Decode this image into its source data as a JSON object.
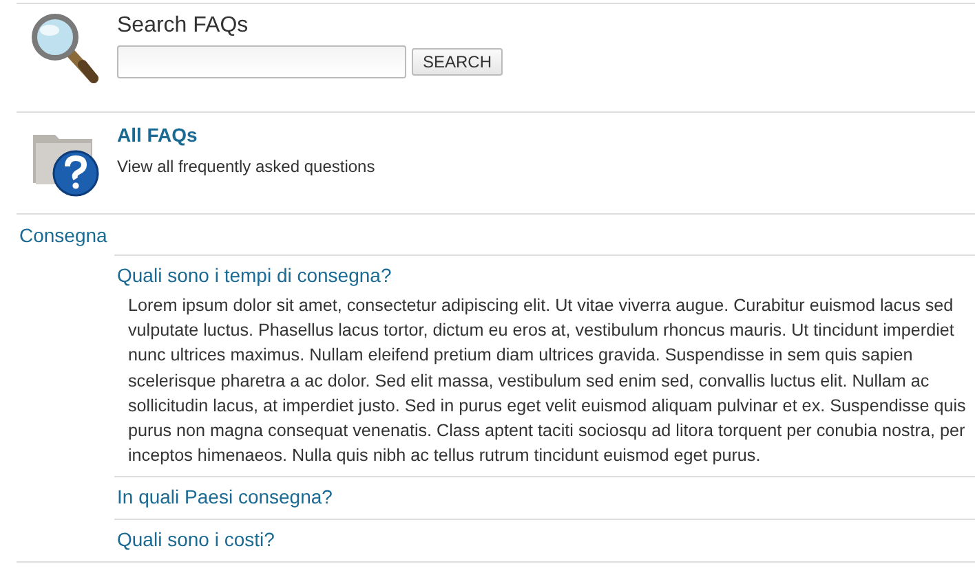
{
  "search": {
    "title": "Search FAQs",
    "button": "SEARCH"
  },
  "all_faqs": {
    "title": "All FAQs",
    "description": "View all frequently asked questions"
  },
  "categories": [
    {
      "name": "Consegna",
      "questions": [
        {
          "question": "Quali sono i tempi di consegna?",
          "answer": "Lorem ipsum dolor sit amet, consectetur adipiscing elit. Ut vitae viverra augue. Curabitur euismod lacus sed vulputate luctus. Phasellus lacus tortor, dictum eu eros at, vestibulum rhoncus mauris. Ut tincidunt imperdiet nunc ultrices maximus. Nullam eleifend pretium diam ultrices gravida. Suspendisse in sem quis sapien scelerisque pharetra a ac dolor. Sed elit massa, vestibulum sed enim sed, convallis luctus elit. Nullam ac sollicitudin lacus, at imperdiet justo. Sed in purus eget velit euismod aliquam pulvinar et ex. Suspendisse quis purus non magna consequat venenatis. Class aptent taciti sociosqu ad litora torquent per conubia nostra, per inceptos himenaeos. Nulla quis nibh ac tellus rutrum tincidunt euismod eget purus."
        },
        {
          "question": "In quali Paesi consegna?"
        },
        {
          "question": "Quali sono i costi?"
        }
      ]
    }
  ]
}
